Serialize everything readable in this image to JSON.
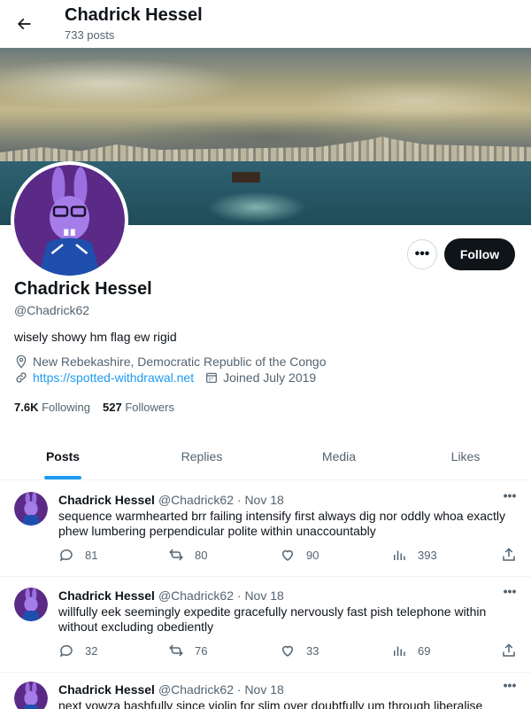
{
  "header": {
    "title": "Chadrick Hessel",
    "post_count": "733 posts"
  },
  "profile": {
    "name": "Chadrick Hessel",
    "handle": "@Chadrick62",
    "bio": "wisely showy hm flag ew rigid",
    "location": "New Rebekashire, Democratic Republic of the Congo",
    "website": "https://spotted-withdrawal.net",
    "joined": "Joined July 2019",
    "following_count": "7.6K",
    "following_label": "Following",
    "followers_count": "527",
    "followers_label": "Followers",
    "more_label": "•••",
    "follow_label": "Follow"
  },
  "tabs": [
    {
      "label": "Posts",
      "active": true
    },
    {
      "label": "Replies",
      "active": false
    },
    {
      "label": "Media",
      "active": false
    },
    {
      "label": "Likes",
      "active": false
    }
  ],
  "posts": [
    {
      "name": "Chadrick Hessel",
      "handle": "@Chadrick62",
      "sep": "·",
      "date": "Nov 18",
      "text": "sequence warmhearted brr failing intensify first always dig nor oddly whoa exactly phew lumbering perpendicular polite within unaccountably",
      "replies": "81",
      "reposts": "80",
      "likes": "90",
      "views": "393"
    },
    {
      "name": "Chadrick Hessel",
      "handle": "@Chadrick62",
      "sep": "·",
      "date": "Nov 18",
      "text": "willfully eek seemingly expedite gracefully nervously fast pish telephone within without excluding obediently",
      "replies": "32",
      "reposts": "76",
      "likes": "33",
      "views": "69"
    },
    {
      "name": "Chadrick Hessel",
      "handle": "@Chadrick62",
      "sep": "·",
      "date": "Nov 18",
      "text": "next yowza bashfully since violin for slim over doubtfully um through liberalise"
    }
  ],
  "post_more_label": "•••",
  "colors": {
    "accent": "#1d9bf0",
    "text": "#0f1419",
    "muted": "#536471",
    "follow_bg": "#0f1419"
  }
}
